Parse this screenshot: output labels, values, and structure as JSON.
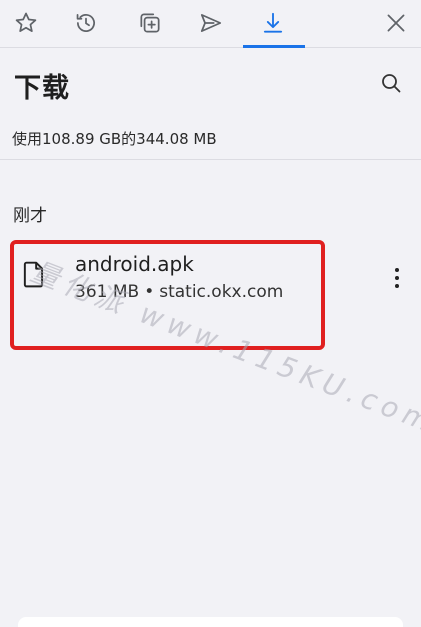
{
  "tabs": [
    {
      "name": "bookmarks",
      "icon": "star-icon"
    },
    {
      "name": "history",
      "icon": "history-icon"
    },
    {
      "name": "add-tab",
      "icon": "add-tab-icon"
    },
    {
      "name": "send",
      "icon": "send-icon"
    },
    {
      "name": "downloads",
      "icon": "download-icon",
      "active": true
    }
  ],
  "header": {
    "title": "下载",
    "storage": "使用108.89 GB的344.08 MB"
  },
  "section": {
    "label": "刚才"
  },
  "download": {
    "name": "android.apk",
    "size": "361 MB",
    "separator": "•",
    "source": "static.okx.com"
  },
  "watermark": "量化派 www.115KU.com",
  "colors": {
    "accent": "#1a73e8",
    "highlight": "#e02020",
    "background": "#f2f2f6"
  }
}
